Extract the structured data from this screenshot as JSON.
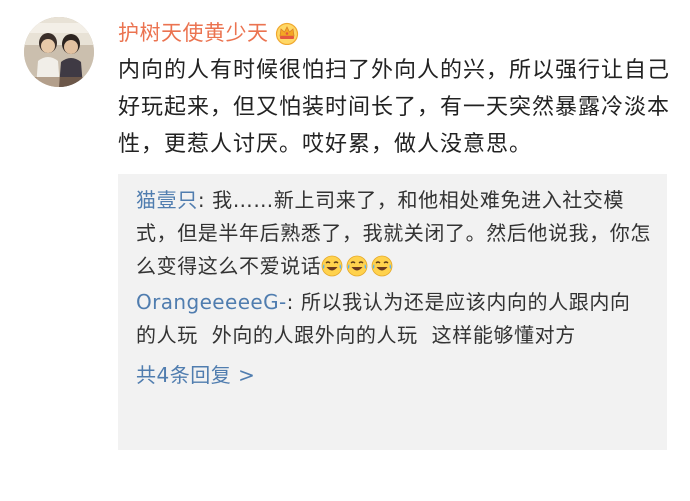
{
  "comment": {
    "username": "护树天使黄少天",
    "badge_icon": "crown-badge-icon",
    "text": "内向的人有时候很怕扫了外向人的兴，所以强行让自己好玩起来，但又怕装时间长了，有一天突然暴露冷淡本性，更惹人讨厌。哎好累，做人没意思。"
  },
  "replies": {
    "items": [
      {
        "author": "猫壹只",
        "separator": ": ",
        "text": "我……新上司来了，和他相处难免进入社交模式，但是半年后熟悉了，我就关闭了。然后他说我，你怎么变得这么不爱说话",
        "emoji_icon": "laugh-cry-emoji-icon",
        "emoji_count": 3
      },
      {
        "author": "OrangeeeeeG-",
        "separator": ": ",
        "text": "所以我认为还是应该内向的人跟内向的人玩  外向的人跟外向的人玩  这样能够懂对方"
      }
    ],
    "more_label": "共4条回复 >"
  },
  "colors": {
    "username": "#eb7350",
    "link": "#507daf",
    "body_text": "#222222",
    "reply_bg": "#f2f2f2"
  }
}
